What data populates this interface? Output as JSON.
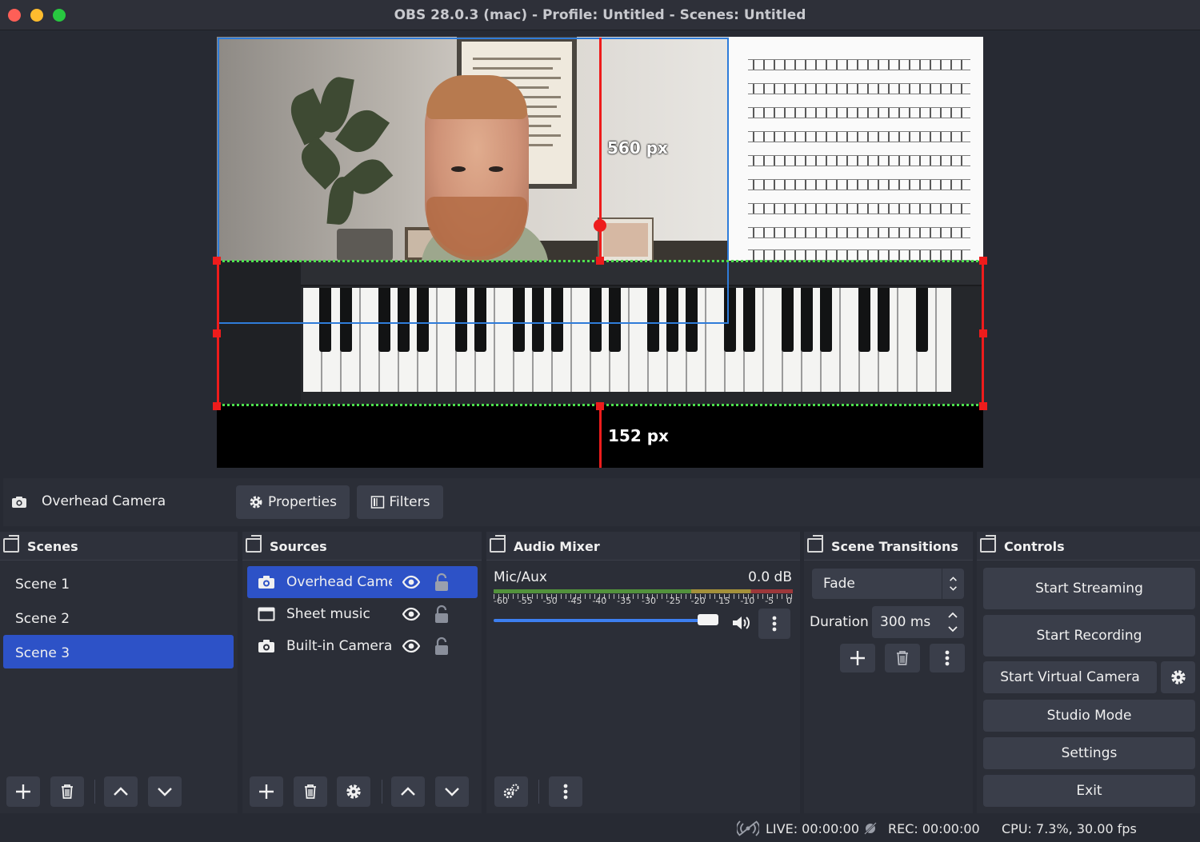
{
  "window": {
    "title": "OBS 28.0.3 (mac) - Profile: Untitled - Scenes: Untitled"
  },
  "preview": {
    "measure_width": "560 px",
    "measure_bottom": "152 px"
  },
  "source_toolbar": {
    "selected_source": "Overhead Camera",
    "properties_label": "Properties",
    "filters_label": "Filters"
  },
  "scenes": {
    "title": "Scenes",
    "items": [
      {
        "label": "Scene 1",
        "active": false
      },
      {
        "label": "Scene 2",
        "active": false
      },
      {
        "label": "Scene 3",
        "active": true
      }
    ]
  },
  "sources": {
    "title": "Sources",
    "items": [
      {
        "label": "Overhead Camer",
        "icon": "camera-icon",
        "active": true
      },
      {
        "label": "Sheet music",
        "icon": "window-icon",
        "active": false
      },
      {
        "label": "Built-in Camera",
        "icon": "camera-icon",
        "active": false
      }
    ]
  },
  "mixer": {
    "title": "Audio Mixer",
    "channel": "Mic/Aux",
    "level": "0.0 dB",
    "ticks": [
      "-60",
      "-55",
      "-50",
      "-45",
      "-40",
      "-35",
      "-30",
      "-25",
      "-20",
      "-15",
      "-10",
      "-5",
      "0"
    ],
    "fader_fraction": 0.97
  },
  "transitions": {
    "title": "Scene Transitions",
    "selected": "Fade",
    "duration_label": "Duration",
    "duration_value": "300 ms"
  },
  "controls": {
    "title": "Controls",
    "start_streaming": "Start Streaming",
    "start_recording": "Start Recording",
    "start_virtual_camera": "Start Virtual Camera",
    "studio_mode": "Studio Mode",
    "settings": "Settings",
    "exit": "Exit"
  },
  "status": {
    "live": "LIVE: 00:00:00",
    "rec": "REC: 00:00:00",
    "cpu": "CPU: 7.3%, 30.00 fps"
  },
  "colors": {
    "accent": "#2d52c7",
    "selection_red": "#ee1c1c",
    "selection_blue": "#2f7cd9",
    "crop_green": "#4ee04e",
    "panel": "#2b2e37",
    "button": "#3a3e4a"
  }
}
